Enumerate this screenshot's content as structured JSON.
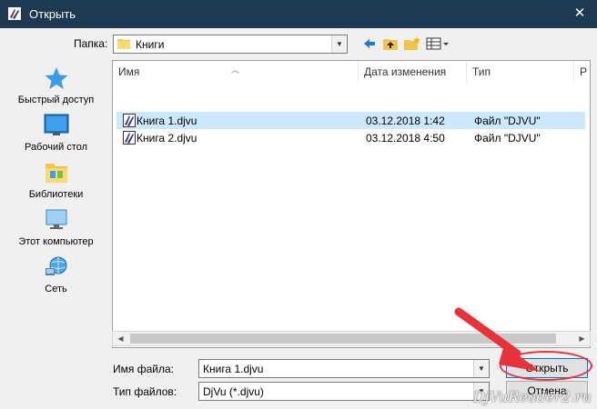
{
  "window": {
    "title": "Открыть"
  },
  "toolbar": {
    "lookin_label": "Папка:",
    "lookin_value": "Книги"
  },
  "places": [
    {
      "label": "Быстрый доступ",
      "icon": "star-icon"
    },
    {
      "label": "Рабочий стол",
      "icon": "desktop-icon"
    },
    {
      "label": "Библиотеки",
      "icon": "libraries-icon"
    },
    {
      "label": "Этот компьютер",
      "icon": "computer-icon"
    },
    {
      "label": "Сеть",
      "icon": "network-icon"
    }
  ],
  "list": {
    "columns": [
      "Имя",
      "Дата изменения",
      "Тип",
      "Р"
    ],
    "rows": [
      {
        "name": "Книга 1.djvu",
        "date": "03.12.2018 1:42",
        "type": "Файл \"DJVU\"",
        "selected": true
      },
      {
        "name": "Книга 2.djvu",
        "date": "03.12.2018 4:50",
        "type": "Файл \"DJVU\"",
        "selected": false
      }
    ]
  },
  "footer": {
    "filename_label": "Имя файла:",
    "filename_value": "Книга 1.djvu",
    "filetype_label": "Тип файлов:",
    "filetype_value": "DjVu (*.djvu)",
    "open_label": "Открыть",
    "cancel_label": "Отмена"
  },
  "watermark": "DjVuReader2.ru",
  "colors": {
    "titlebar": "#1d3a52",
    "selection": "#cce8ff",
    "highlight": "#e8323a"
  }
}
